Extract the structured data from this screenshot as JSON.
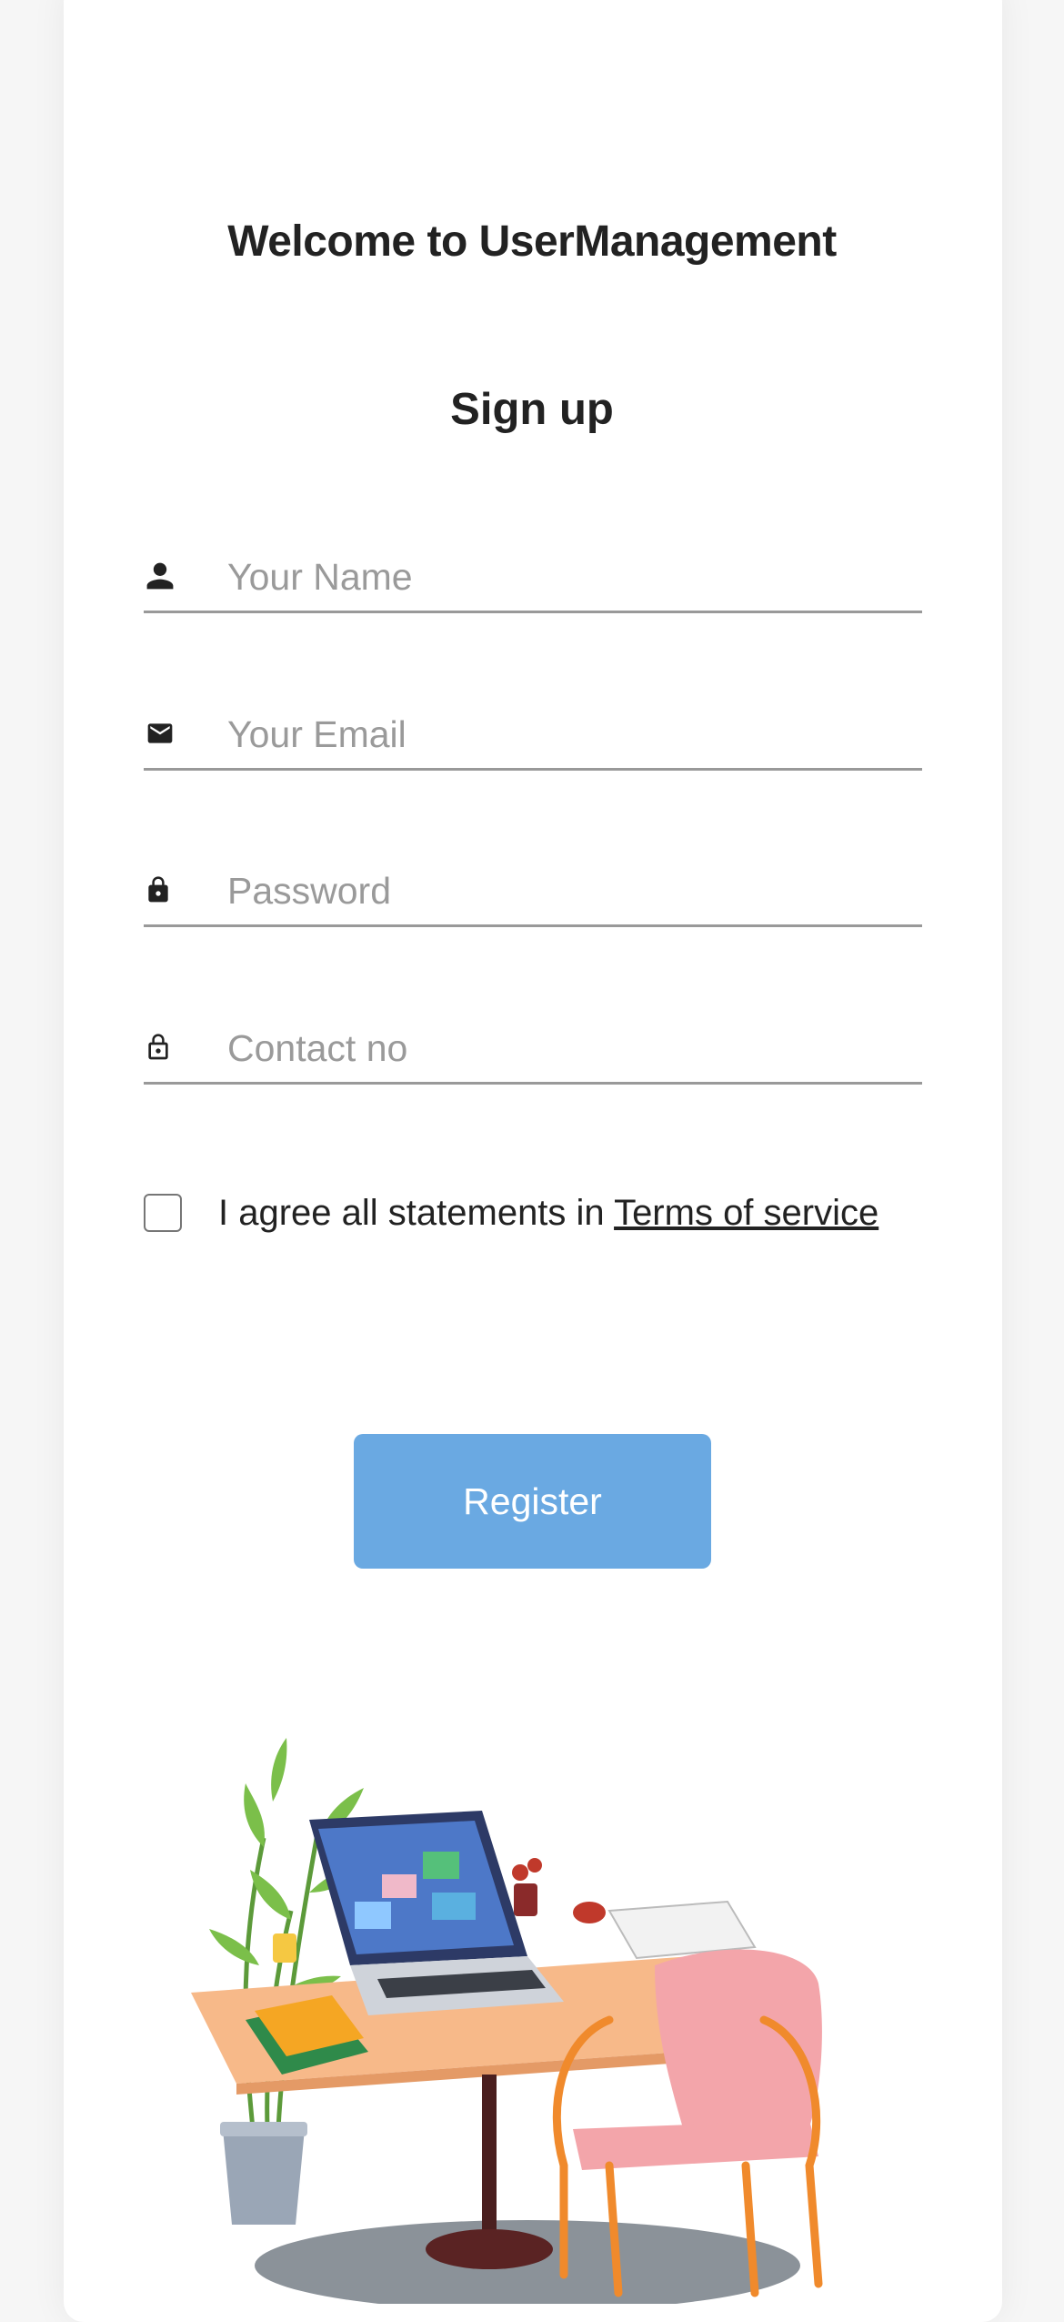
{
  "header": {
    "welcome": "Welcome to UserManagement",
    "title": "Sign up"
  },
  "form": {
    "name": {
      "placeholder": "Your Name",
      "value": "",
      "icon": "person-icon"
    },
    "email": {
      "placeholder": "Your Email",
      "value": "",
      "icon": "mail-icon"
    },
    "password": {
      "placeholder": "Password",
      "value": "",
      "icon": "lock-icon"
    },
    "contact": {
      "placeholder": "Contact no",
      "value": "",
      "icon": "lock-outline-icon"
    },
    "agree_text": "I agree all statements in",
    "terms_link": "Terms of service",
    "agree_checked": false,
    "submit_label": "Register"
  },
  "colors": {
    "accent": "#6aa9e2",
    "background": "#f6f6f6",
    "card": "#ffffff",
    "text": "#222222",
    "placeholder": "#9a9a9a"
  },
  "illustration": {
    "name": "desk-illustration"
  }
}
